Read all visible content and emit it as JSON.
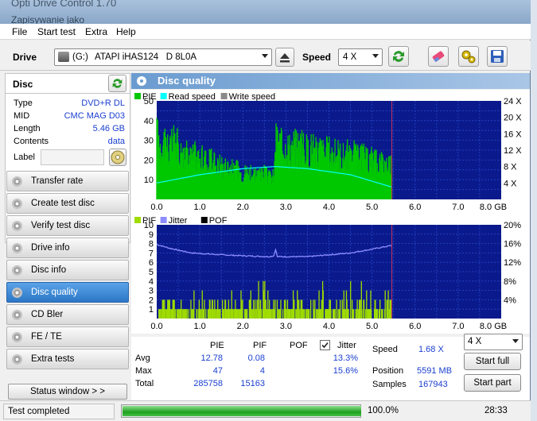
{
  "window": {
    "title": "Opti Drive Control 1.70",
    "subtitle": "Zapisywanie jako"
  },
  "menu": [
    "File",
    "Start test",
    "Extra",
    "Help"
  ],
  "toolbar": {
    "drive_label": "Drive",
    "drive_letter": "(G:)",
    "drive_model": "ATAPI iHAS124   D 8L0A",
    "speed_label": "Speed",
    "speed_value": "4 X"
  },
  "disc": {
    "header": "Disc",
    "rows": [
      {
        "key": "Type",
        "value": "DVD+R DL"
      },
      {
        "key": "MID",
        "value": "CMC MAG D03"
      },
      {
        "key": "Length",
        "value": "5.46 GB"
      },
      {
        "key": "Contents",
        "value": "data"
      }
    ],
    "label_key": "Label",
    "label_value": ""
  },
  "nav": [
    "Transfer rate",
    "Create test disc",
    "Verify test disc",
    "Drive info",
    "Disc info",
    "Disc quality",
    "CD Bler",
    "FE / TE",
    "Extra tests"
  ],
  "nav_active": 5,
  "status_window_btn": "Status window > >",
  "panel_title": "Disc quality",
  "chart_data": [
    {
      "type": "area",
      "legend": [
        "PIE",
        "Read speed",
        "Write speed"
      ],
      "colors": {
        "pie": "#00c800",
        "read": "#00ffff",
        "write": "#8a8a8a",
        "bg": "#0a1a8c",
        "grid": "#2a44c8",
        "end": "#c8325a"
      },
      "xlim": [
        0,
        8
      ],
      "x_ticks": [
        "0.0",
        "1.0",
        "2.0",
        "3.0",
        "4.0",
        "5.0",
        "6.0",
        "7.0",
        "8.0 GB"
      ],
      "ylim": [
        0,
        50
      ],
      "y_ticks": [
        "10",
        "20",
        "30",
        "40",
        "50"
      ],
      "y2_ticks": [
        "4 X",
        "8 X",
        "12 X",
        "16 X",
        "20 X",
        "24 X"
      ],
      "data_end": 5.46,
      "pie_profile": [
        [
          0.0,
          44
        ],
        [
          0.1,
          38
        ],
        [
          0.2,
          42
        ],
        [
          0.3,
          33
        ],
        [
          0.4,
          40
        ],
        [
          0.5,
          36
        ],
        [
          0.6,
          30
        ],
        [
          0.7,
          32
        ],
        [
          0.8,
          28
        ],
        [
          0.9,
          31
        ],
        [
          1.0,
          26
        ],
        [
          1.1,
          29
        ],
        [
          1.2,
          24
        ],
        [
          1.3,
          27
        ],
        [
          1.4,
          22
        ],
        [
          1.5,
          25
        ],
        [
          1.6,
          21
        ],
        [
          1.7,
          23
        ],
        [
          1.8,
          19
        ],
        [
          1.9,
          21
        ],
        [
          2.0,
          18
        ],
        [
          2.1,
          20
        ],
        [
          2.2,
          17
        ],
        [
          2.3,
          19
        ],
        [
          2.4,
          16
        ],
        [
          2.5,
          18
        ],
        [
          2.6,
          15
        ],
        [
          2.7,
          16
        ],
        [
          2.73,
          15
        ],
        [
          2.75,
          40
        ],
        [
          2.8,
          42
        ],
        [
          2.9,
          36
        ],
        [
          3.0,
          38
        ],
        [
          3.1,
          35
        ],
        [
          3.2,
          38
        ],
        [
          3.3,
          34
        ],
        [
          3.4,
          37
        ],
        [
          3.5,
          33
        ],
        [
          3.6,
          36
        ],
        [
          3.7,
          32
        ],
        [
          3.8,
          35
        ],
        [
          3.9,
          31
        ],
        [
          4.0,
          34
        ],
        [
          4.1,
          30
        ],
        [
          4.2,
          33
        ],
        [
          4.3,
          29
        ],
        [
          4.4,
          32
        ],
        [
          4.5,
          28
        ],
        [
          4.6,
          31
        ],
        [
          4.7,
          27
        ],
        [
          4.8,
          30
        ],
        [
          4.9,
          26
        ],
        [
          5.0,
          29
        ],
        [
          5.1,
          25
        ],
        [
          5.2,
          27
        ],
        [
          5.3,
          24
        ],
        [
          5.4,
          26
        ],
        [
          5.46,
          22
        ]
      ],
      "read_profile": [
        [
          0.0,
          4
        ],
        [
          1.0,
          6
        ],
        [
          2.0,
          7.5
        ],
        [
          2.75,
          8
        ],
        [
          3.5,
          7.5
        ],
        [
          4.5,
          6
        ],
        [
          5.46,
          3
        ]
      ]
    },
    {
      "type": "bar",
      "legend": [
        "PIF",
        "Jitter",
        "POF"
      ],
      "colors": {
        "pif": "#a0dc00",
        "jitter": "#8c8cff",
        "pof": "#000000",
        "bg": "#0a1a8c",
        "grid": "#2a44c8",
        "end": "#c8325a"
      },
      "xlim": [
        0,
        8
      ],
      "x_ticks": [
        "0.0",
        "1.0",
        "2.0",
        "3.0",
        "4.0",
        "5.0",
        "6.0",
        "7.0",
        "8.0 GB"
      ],
      "ylim": [
        0,
        10
      ],
      "y_ticks": [
        "1",
        "2",
        "3",
        "4",
        "5",
        "6",
        "7",
        "8",
        "9",
        "10"
      ],
      "y2_ticks": [
        "4%",
        "8%",
        "12%",
        "16%",
        "20%"
      ],
      "data_end": 5.46,
      "pif_max": 4,
      "jitter_profile": [
        [
          0.0,
          7.9
        ],
        [
          0.3,
          7.5
        ],
        [
          0.8,
          7.0
        ],
        [
          1.5,
          6.8
        ],
        [
          2.0,
          6.7
        ],
        [
          2.6,
          6.6
        ],
        [
          2.72,
          6.7
        ],
        [
          2.76,
          7.4
        ],
        [
          2.8,
          6.6
        ],
        [
          3.5,
          6.6
        ],
        [
          4.0,
          6.8
        ],
        [
          4.5,
          7.0
        ],
        [
          5.0,
          7.4
        ],
        [
          5.46,
          7.8
        ]
      ]
    }
  ],
  "stats": {
    "headers": [
      "PIE",
      "PIF",
      "POF",
      "Jitter"
    ],
    "jitter_checked": true,
    "rows": [
      {
        "label": "Avg",
        "pie": "12.78",
        "pif": "0.08",
        "pof": "",
        "jitter": "13.3%"
      },
      {
        "label": "Max",
        "pie": "47",
        "pif": "4",
        "pof": "",
        "jitter": "15.6%"
      },
      {
        "label": "Total",
        "pie": "285758",
        "pif": "15163",
        "pof": "",
        "jitter": ""
      }
    ],
    "speed_label": "Speed",
    "speed_value": "1.68 X",
    "position_label": "Position",
    "position_value": "5591 MB",
    "samples_label": "Samples",
    "samples_value": "167943",
    "speed_select": "4 X",
    "start_full": "Start full",
    "start_part": "Start part"
  },
  "status": {
    "text": "Test completed",
    "progress": 100.0,
    "progress_text": "100.0%",
    "time": "28:33"
  }
}
